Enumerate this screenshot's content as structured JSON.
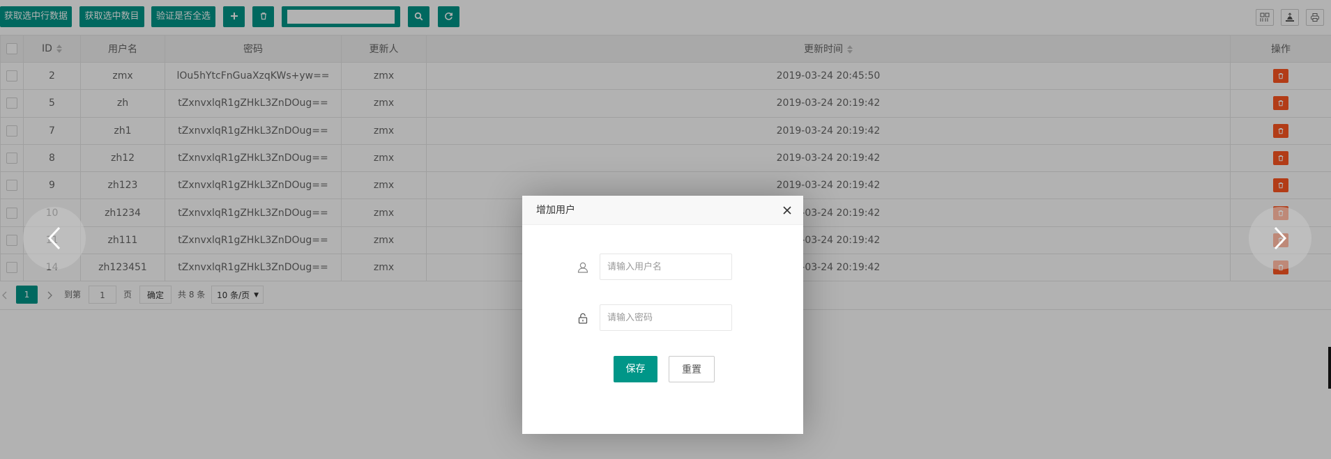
{
  "toolbar": {
    "btn_get_checked_rows": "获取选中行数据",
    "btn_get_checked_count": "获取选中数目",
    "btn_verify_all": "验证是否全选",
    "search_value": ""
  },
  "table": {
    "headers": {
      "id": "ID",
      "username": "用户名",
      "password": "密码",
      "updater": "更新人",
      "updated_time": "更新时间",
      "action": "操作"
    },
    "rows": [
      {
        "id": "2",
        "username": "zmx",
        "password": "lOu5hYtcFnGuaXzqKWs+yw==",
        "updater": "zmx",
        "updated_time": "2019-03-24 20:45:50"
      },
      {
        "id": "5",
        "username": "zh",
        "password": "tZxnvxlqR1gZHkL3ZnDOug==",
        "updater": "zmx",
        "updated_time": "2019-03-24 20:19:42"
      },
      {
        "id": "7",
        "username": "zh1",
        "password": "tZxnvxlqR1gZHkL3ZnDOug==",
        "updater": "zmx",
        "updated_time": "2019-03-24 20:19:42"
      },
      {
        "id": "8",
        "username": "zh12",
        "password": "tZxnvxlqR1gZHkL3ZnDOug==",
        "updater": "zmx",
        "updated_time": "2019-03-24 20:19:42"
      },
      {
        "id": "9",
        "username": "zh123",
        "password": "tZxnvxlqR1gZHkL3ZnDOug==",
        "updater": "zmx",
        "updated_time": "2019-03-24 20:19:42"
      },
      {
        "id": "10",
        "username": "zh1234",
        "password": "tZxnvxlqR1gZHkL3ZnDOug==",
        "updater": "zmx",
        "updated_time": "2019-03-24 20:19:42"
      },
      {
        "id": "11",
        "username": "zh111",
        "password": "tZxnvxlqR1gZHkL3ZnDOug==",
        "updater": "zmx",
        "updated_time": "2019-03-24 20:19:42"
      },
      {
        "id": "14",
        "username": "zh123451",
        "password": "tZxnvxlqR1gZHkL3ZnDOug==",
        "updater": "zmx",
        "updated_time": "2019-03-24 20:19:42"
      }
    ]
  },
  "pager": {
    "current_page": "1",
    "goto_label": "到第",
    "goto_value": "1",
    "page_unit": "页",
    "confirm": "确定",
    "total": "共 8 条",
    "page_size": "10 条/页"
  },
  "modal": {
    "title": "增加用户",
    "username_placeholder": "请输入用户名",
    "password_placeholder": "请输入密码",
    "save_label": "保存",
    "reset_label": "重置"
  },
  "colors": {
    "accent": "#009688",
    "danger": "#FF5722"
  }
}
